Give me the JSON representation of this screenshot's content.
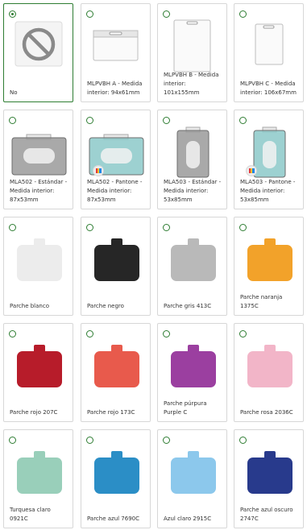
{
  "options": [
    {
      "label": "No",
      "selected": true,
      "thumb": "none-icon"
    },
    {
      "label": "MLPVBH A - Medida interior: 94x61mm",
      "thumb": "holder-horizontal-icon"
    },
    {
      "label": "MLPVBH B - Medida interior: 101x155mm",
      "thumb": "holder-vertical-tall-icon"
    },
    {
      "label": "MLPVBH C - Medida interior: 106x67mm",
      "thumb": "holder-vertical-icon"
    },
    {
      "label": "MLA502 - Estándar - Medida interior: 87x53mm",
      "thumb": "rigid-horizontal-icon",
      "color": "#9a9a9a"
    },
    {
      "label": "MLA502 - Pantone - Medida interior: 87x53mm",
      "thumb": "rigid-horizontal-icon",
      "color": "#8cc9c9",
      "pantone": true
    },
    {
      "label": "MLA503 - Estándar - Medida interior: 53x85mm",
      "thumb": "rigid-vertical-icon",
      "color": "#9a9a9a"
    },
    {
      "label": "MLA503 - Pantone - Medida interior: 53x85mm",
      "thumb": "rigid-vertical-icon",
      "color": "#8cc9c9",
      "pantone": true
    },
    {
      "label": "Parche blanco",
      "thumb": "patch-icon",
      "color": "#ececec"
    },
    {
      "label": "Parche negro",
      "thumb": "patch-icon",
      "color": "#262626"
    },
    {
      "label": "Parche gris 413C",
      "thumb": "patch-icon",
      "color": "#b9b9b9"
    },
    {
      "label": "Parche naranja 1375C",
      "thumb": "patch-icon",
      "color": "#f2a22a"
    },
    {
      "label": "Parche rojo 207C",
      "thumb": "patch-icon",
      "color": "#b71c2a"
    },
    {
      "label": "Parche rojo 173C",
      "thumb": "patch-icon",
      "color": "#e85a4c"
    },
    {
      "label": "Parche púrpura Purple C",
      "thumb": "patch-icon",
      "color": "#9b3fa0"
    },
    {
      "label": "Parche rosa 2036C",
      "thumb": "patch-icon",
      "color": "#f2b5c8"
    },
    {
      "label": "Turquesa claro 0921C",
      "thumb": "patch-icon",
      "color": "#99cfba"
    },
    {
      "label": "Parche azul 7690C",
      "thumb": "patch-icon",
      "color": "#2b8ec6"
    },
    {
      "label": "Azul claro 2915C",
      "thumb": "patch-icon",
      "color": "#8cc8ec"
    },
    {
      "label": "Parche azul oscuro 2747C",
      "thumb": "patch-icon",
      "color": "#283a8c"
    }
  ]
}
